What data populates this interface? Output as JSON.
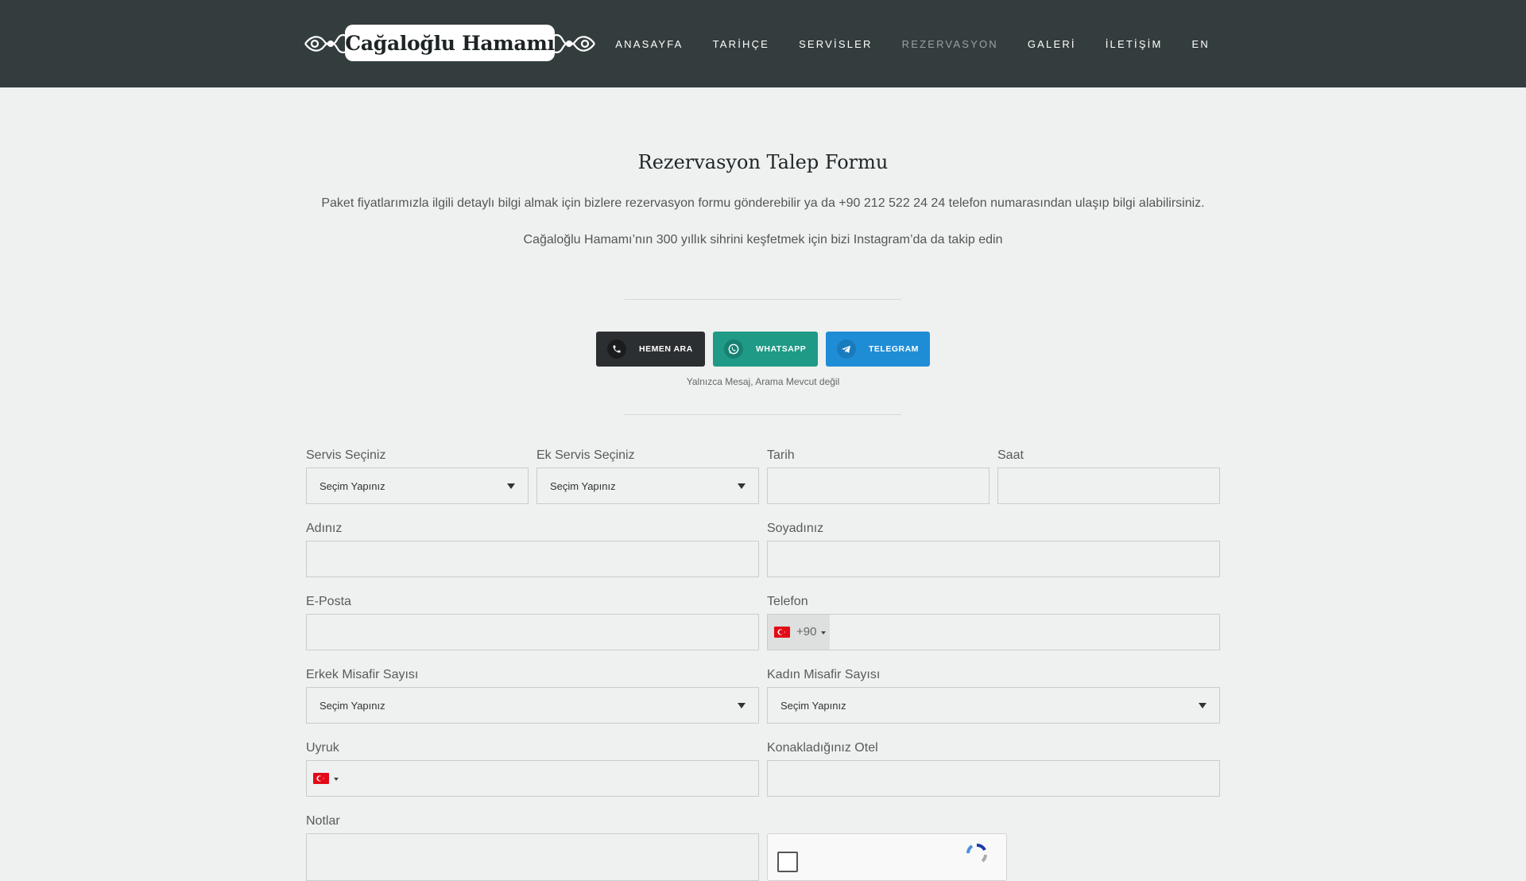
{
  "header": {
    "logo_text": "Cağaloğlu Hamamı",
    "nav": [
      {
        "label": "ANASAYFA",
        "active": false
      },
      {
        "label": "TARİHÇE",
        "active": false
      },
      {
        "label": "SERVİSLER",
        "active": false
      },
      {
        "label": "REZERVASYON",
        "active": true
      },
      {
        "label": "GALERİ",
        "active": false
      },
      {
        "label": "İLETİŞİM",
        "active": false
      },
      {
        "label": "EN",
        "active": false
      }
    ]
  },
  "intro": {
    "title": "Rezervasyon Talep Formu",
    "text1": "Paket fiyatlarımızla ilgili detaylı bilgi almak için bizlere rezervasyon formu gönderebilir ya da +90 212 522 24 24 telefon numarasından ulaşıp bilgi alabilirsiniz.",
    "text2": "Cağaloğlu Hamamı’nın 300 yıllık sihrini keşfetmek için bizi Instagram’da da takip edin"
  },
  "contact_buttons": {
    "call": "HEMEN ARA",
    "whatsapp": "WHATSAPP",
    "telegram": "TELEGRAM",
    "note": "Yalnızca Mesaj, Arama Mevcut değil"
  },
  "form": {
    "service_label": "Servis Seçiniz",
    "service_value": "Seçim Yapınız",
    "extra_service_label": "Ek Servis Seçiniz",
    "extra_service_value": "Seçim Yapınız",
    "date_label": "Tarih",
    "time_label": "Saat",
    "first_name_label": "Adınız",
    "last_name_label": "Soyadınız",
    "email_label": "E-Posta",
    "phone_label": "Telefon",
    "phone_code": "+90",
    "male_guests_label": "Erkek Misafir Sayısı",
    "male_guests_value": "Seçim Yapınız",
    "female_guests_label": "Kadın Misafir Sayısı",
    "female_guests_value": "Seçim Yapınız",
    "nationality_label": "Uyruk",
    "hotel_label": "Konakladığınız Otel",
    "notes_label": "Notlar"
  },
  "colors": {
    "header_bg": "#343d3e",
    "page_bg": "#eef1f0",
    "call_btn": "#2b2f31",
    "whatsapp_btn": "#1e9a86",
    "telegram_btn": "#1f8dd6",
    "flag_red": "#e30a17"
  },
  "icons": [
    "phone-icon",
    "whatsapp-icon",
    "telegram-icon",
    "turkey-flag-icon",
    "chevron-down-icon",
    "recaptcha-icon"
  ]
}
